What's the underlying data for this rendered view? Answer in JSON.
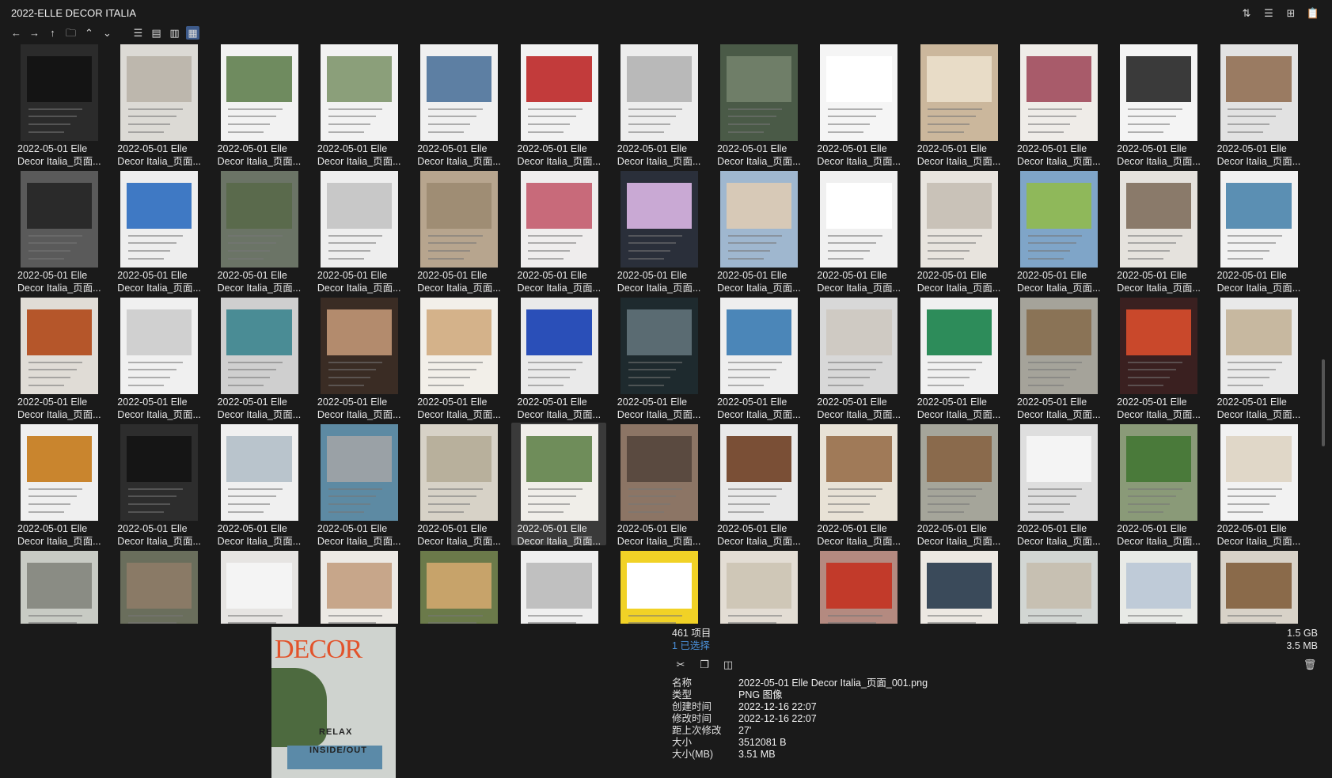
{
  "window": {
    "title": "2022-ELLE DECOR ITALIA"
  },
  "top_right_icons": [
    "sort-icon",
    "details-list-icon",
    "add-pane-icon",
    "clipboard-icon"
  ],
  "toolbar": {
    "nav": [
      "back-icon",
      "forward-icon",
      "up-icon",
      "folder-nav-icon",
      "chevron-up-icon",
      "chevron-down-icon"
    ],
    "views": [
      "list-view-icon",
      "detail-view-icon",
      "tree-view-icon",
      "thumbnail-view-icon"
    ]
  },
  "grid": {
    "caption_line1": "2022-05-01 Elle",
    "caption_line2": "Decor Italia_页面...",
    "selected_index": 44,
    "thumbs": [
      "#2b2b2b",
      "#dcdad5",
      "#f2f2f2",
      "#f2f2f2",
      "#f0f0f0",
      "#f2f2f2",
      "#ededed",
      "#4a5a47",
      "#f5f5f5",
      "#cbb79c",
      "#efece8",
      "#f4f4f4",
      "#e2e2e2",
      "#5a5a5a",
      "#eeeeee",
      "#6b7466",
      "#eeeeee",
      "#b7a58e",
      "#efeded",
      "#2a2f3a",
      "#9fb7cf",
      "#f0f0f0",
      "#e8e4de",
      "#7fa5c8",
      "#e5e2dd",
      "#f1f1f1",
      "#e0dcd6",
      "#f0f0f0",
      "#cfcfcf",
      "#3a2c24",
      "#f2efe9",
      "#eaeaea",
      "#1e2a2e",
      "#eeeeee",
      "#d8d8d8",
      "#f0f0f0",
      "#a5a39a",
      "#3a2020",
      "#e9e9e9",
      "#efefef",
      "#2d2d2d",
      "#f0f0f0",
      "#5d8aa3",
      "#d7d2c7",
      "#f0eee9",
      "#8c7565",
      "#e9e9e9",
      "#e8e2d6",
      "#a5a59a",
      "#dedede",
      "#8a9a78",
      "#f2f2f2",
      "#c8cbc4",
      "#6a6e5c",
      "#e6e4e2",
      "#ece9e4",
      "#6b7a4a",
      "#efefef",
      "#f1d226",
      "#e3ddd4",
      "#b48a80",
      "#ece8e2",
      "#d2d6d3",
      "#e8eae6",
      "#d8d2c8"
    ],
    "pics": [
      "#141414",
      "#bdb7ad",
      "#6f8b5f",
      "#8b9f7a",
      "#5d7fa3",
      "#c23b3b",
      "#b9b9b9",
      "#6f7e68",
      "#ffffff",
      "#e8dcc7",
      "#a85b6a",
      "#3a3a3a",
      "#9a7b62",
      "#2a2a2a",
      "#3f79c4",
      "#5a6a4c",
      "#c8c8c8",
      "#9f8d74",
      "#c86a7a",
      "#c9a9d4",
      "#d7c9b7",
      "#ffffff",
      "#c9c2b8",
      "#8fb85a",
      "#8a7a6a",
      "#5b8fb3",
      "#b5562a",
      "#d0d0d0",
      "#4a8c95",
      "#b38b6d",
      "#d4b28a",
      "#2a4fb8",
      "#5a6b72",
      "#4b86b8",
      "#cfcac3",
      "#2d8c5a",
      "#8a7356",
      "#c9482b",
      "#c7b8a0",
      "#c9852e",
      "#151515",
      "#b9c4cc",
      "#9aa1a6",
      "#b8b09c",
      "#6f8d5a",
      "#5a4a40",
      "#7a4f36",
      "#a07a58",
      "#8a6a4c",
      "#f4f4f4",
      "#4a7a3a",
      "#e0d7c8",
      "#8a8c84",
      "#8a7a66",
      "#f4f4f4",
      "#c7a68a",
      "#c7a36a",
      "#c0c0c0",
      "#ffffff",
      "#cfc7b7",
      "#c23a2a",
      "#3a4a5a",
      "#c7c0b2",
      "#bfcbd8",
      "#8a6a4a"
    ]
  },
  "status": {
    "item_count": "461 项目",
    "selected": "1 已选择",
    "total_size": "1.5 GB",
    "selected_size": "3.5 MB"
  },
  "actions": [
    "cut-icon",
    "copy-icon",
    "compare-icon"
  ],
  "preview": {
    "brand": "DECOR",
    "line1": "RELAX",
    "line2": "INSIDE/OUT"
  },
  "properties": [
    {
      "k": "名称",
      "v": "2022-05-01 Elle Decor Italia_页面_001.png"
    },
    {
      "k": "类型",
      "v": "PNG 图像"
    },
    {
      "k": "创建时间",
      "v": "2022-12-16  22:07"
    },
    {
      "k": "修改时间",
      "v": "2022-12-16  22:07"
    },
    {
      "k": "距上次修改",
      "v": "27'"
    },
    {
      "k": "大小",
      "v": "3512081 B"
    },
    {
      "k": "大小(MB)",
      "v": "3.51 MB"
    }
  ],
  "colors": {
    "background": "#1a1a1a",
    "selection": "#3a3a3a",
    "accent": "#4a8fd8"
  }
}
